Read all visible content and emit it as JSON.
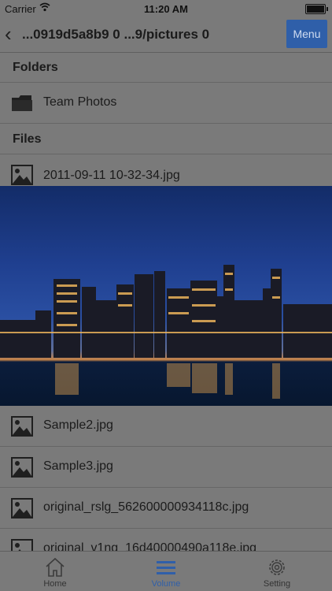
{
  "status": {
    "carrier": "Carrier",
    "time": "11:20 AM"
  },
  "nav": {
    "title": "...0919d5a8b9 0 ...9/pictures 0",
    "menu": "Menu"
  },
  "sections": {
    "folders": "Folders",
    "files": "Files"
  },
  "folders": [
    {
      "name": "Team Photos"
    }
  ],
  "files": [
    {
      "name": "2011-09-11 10-32-34.jpg"
    },
    {
      "name": "Sample2.jpg"
    },
    {
      "name": "Sample3.jpg"
    },
    {
      "name": "original_rslg_562600000934118c.jpg"
    },
    {
      "name": "original_v1ng_16d40000490a118e.jpg"
    }
  ],
  "tabs": [
    {
      "label": "Home",
      "icon": "home-icon"
    },
    {
      "label": "Volume",
      "icon": "list-icon",
      "active": true
    },
    {
      "label": "Setting",
      "icon": "gear-icon"
    }
  ],
  "colors": {
    "accent": "#2f5fa9",
    "background": "#7a7a7a"
  }
}
